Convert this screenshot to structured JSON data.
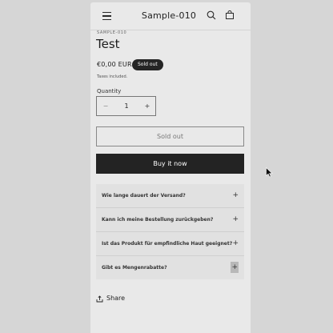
{
  "header": {
    "brand": "Sample-010",
    "menu_icon": "menu-icon",
    "search_icon": "search-icon",
    "cart_icon": "cart-icon"
  },
  "product": {
    "vendor": "SAMPLE-010",
    "title": "Test",
    "price": "€0,00 EUR",
    "badge": "Sold out",
    "taxes": "Taxes included."
  },
  "quantity": {
    "label": "Quantity",
    "minus": "−",
    "value": "1",
    "plus": "+"
  },
  "buttons": {
    "sold_out": "Sold out",
    "buy_now": "Buy it now"
  },
  "accordion": [
    {
      "label": "Wie lange dauert der Versand?",
      "icon": "+"
    },
    {
      "label": "Kann ich meine Bestellung zurückgeben?",
      "icon": "+"
    },
    {
      "label": "Ist das Produkt für empfindliche Haut geeignet?",
      "icon": "+"
    },
    {
      "label": "Gibt es Mengenrabatte?",
      "icon": "+"
    }
  ],
  "share": {
    "label": "Share",
    "icon": "share-icon"
  },
  "colors": {
    "background": "#d6d6d6",
    "page": "#e9e9e9",
    "dark": "#232323",
    "accordion": "#e1e1e1"
  }
}
